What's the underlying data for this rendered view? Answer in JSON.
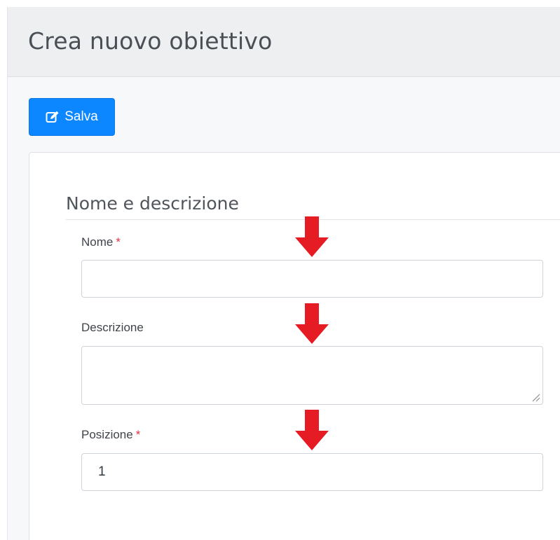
{
  "header": {
    "title": "Crea nuovo obiettivo"
  },
  "toolbar": {
    "save_label": "Salva",
    "save_icon": "edit-square-icon"
  },
  "form": {
    "section_title": "Nome e descrizione",
    "required_marker": "*",
    "fields": {
      "nome": {
        "label": "Nome",
        "required": true,
        "value": ""
      },
      "descrizione": {
        "label": "Descrizione",
        "required": false,
        "value": ""
      },
      "posizione": {
        "label": "Posizione",
        "required": true,
        "value": "1"
      }
    }
  },
  "annotations": {
    "arrow_icon": "down-arrow-icon",
    "arrow_color": "#e51c23",
    "count": 3
  },
  "colors": {
    "primary": "#0d87ff",
    "required": "#dc3545",
    "header_bg": "#edeff1"
  }
}
